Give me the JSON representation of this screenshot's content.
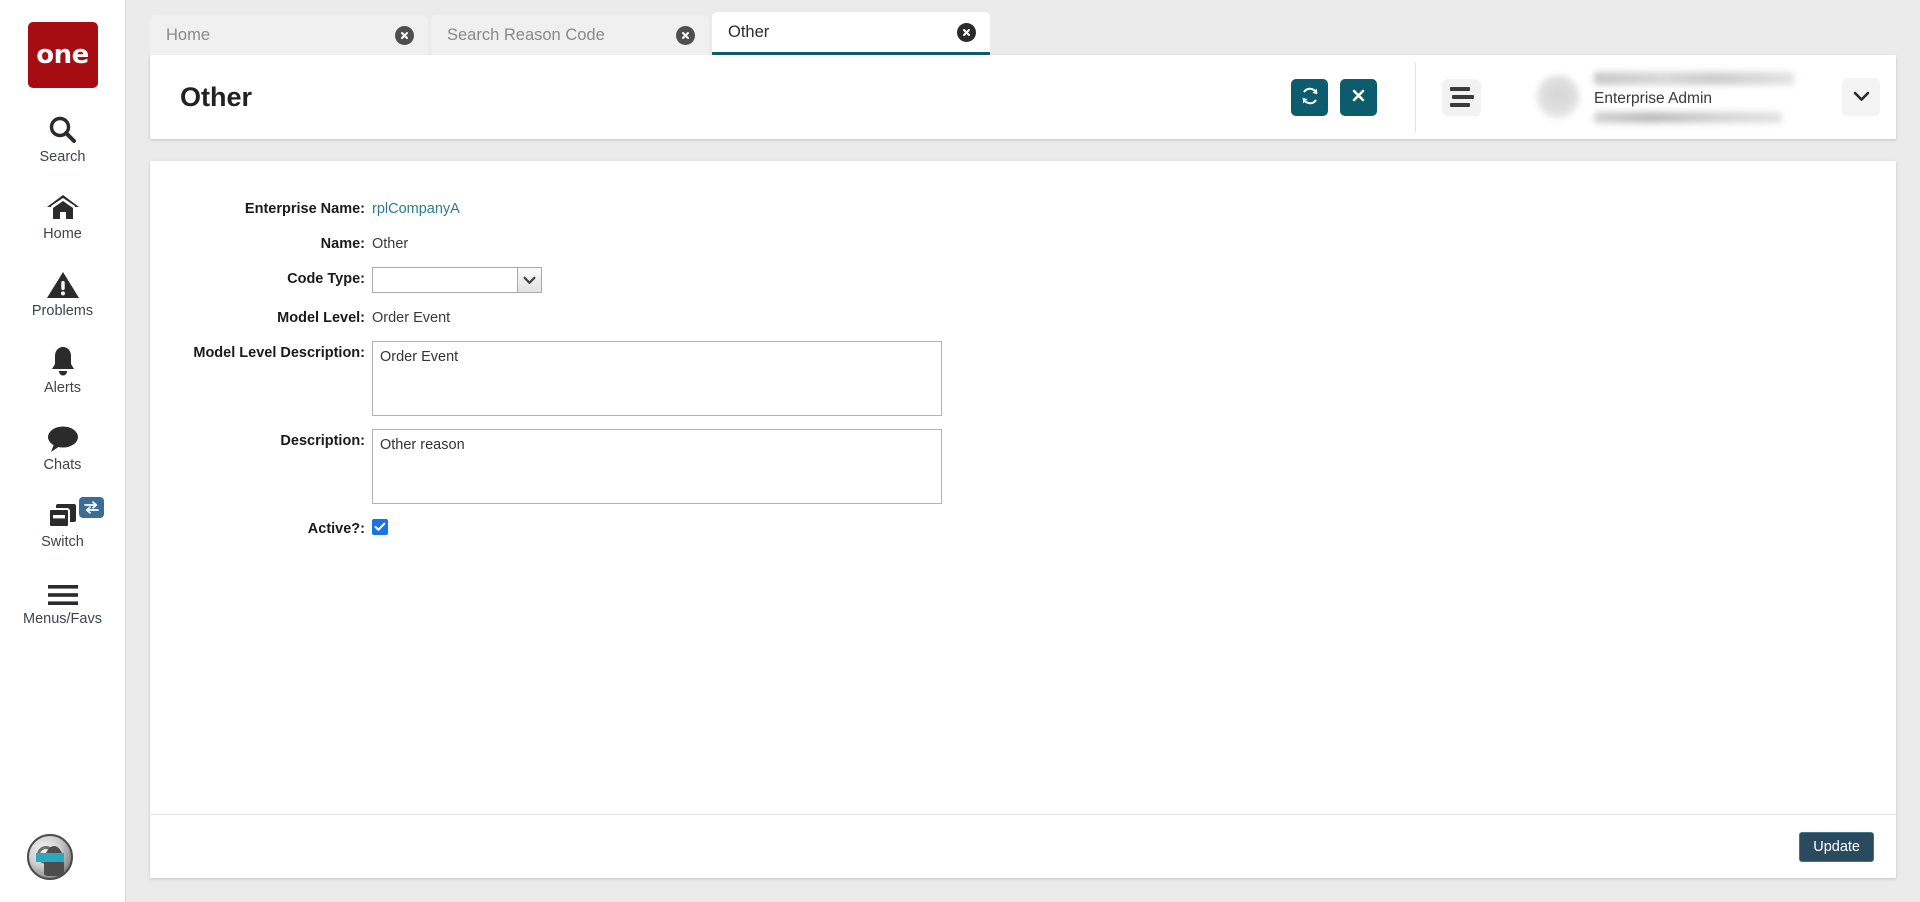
{
  "sidebar": {
    "logo_text": "one",
    "items": [
      {
        "label": "Search",
        "icon": "search-icon"
      },
      {
        "label": "Home",
        "icon": "home-icon"
      },
      {
        "label": "Problems",
        "icon": "warning-triangle-icon"
      },
      {
        "label": "Alerts",
        "icon": "bell-icon"
      },
      {
        "label": "Chats",
        "icon": "chat-bubble-icon"
      },
      {
        "label": "Switch",
        "icon": "windows-stack-icon",
        "badge_icon": "swap-arrows-icon"
      },
      {
        "label": "Menus/Favs",
        "icon": "hamburger-icon"
      }
    ],
    "bottom_avatar_icon": "user-profile-avatar-icon"
  },
  "tabs": [
    {
      "label": "Home",
      "active": false
    },
    {
      "label": "Search Reason Code",
      "active": false
    },
    {
      "label": "Other",
      "active": true
    }
  ],
  "header": {
    "title": "Other",
    "refresh_icon": "refresh-icon",
    "close_icon": "close-x-icon",
    "menu_icon": "hamburger-menu-icon",
    "user_role": "Enterprise Admin",
    "caret_icon": "chevron-down-icon"
  },
  "form": {
    "fields": [
      {
        "label": "Enterprise Name:",
        "value": "rplCompanyA",
        "type": "link"
      },
      {
        "label": "Name:",
        "value": "Other",
        "type": "text"
      },
      {
        "label": "Code Type:",
        "value": "",
        "type": "select"
      },
      {
        "label": "Model Level:",
        "value": "Order Event",
        "type": "text"
      },
      {
        "label": "Model Level Description:",
        "value": "Order Event",
        "type": "textarea"
      },
      {
        "label": "Description:",
        "value": "Other reason",
        "type": "textarea"
      },
      {
        "label": "Active?:",
        "value": "",
        "type": "checkbox",
        "checked": true
      }
    ],
    "enterprise_name_label": "Enterprise Name:",
    "enterprise_name_value": "rplCompanyA",
    "name_label": "Name:",
    "name_value": "Other",
    "code_type_label": "Code Type:",
    "code_type_value": "",
    "model_level_label": "Model Level:",
    "model_level_value": "Order Event",
    "model_level_desc_label": "Model Level Description:",
    "model_level_desc_value": "Order Event",
    "description_label": "Description:",
    "description_value": "Other reason",
    "active_label": "Active?:"
  },
  "footer": {
    "update_label": "Update"
  },
  "colors": {
    "brand_red": "#a60c11",
    "teal_accent": "#0d5c6e",
    "link_teal": "#2c7c91",
    "checkbox_blue": "#1a73e8",
    "update_navy": "#2a4a5e",
    "switch_badge_blue": "#3b6e94"
  }
}
